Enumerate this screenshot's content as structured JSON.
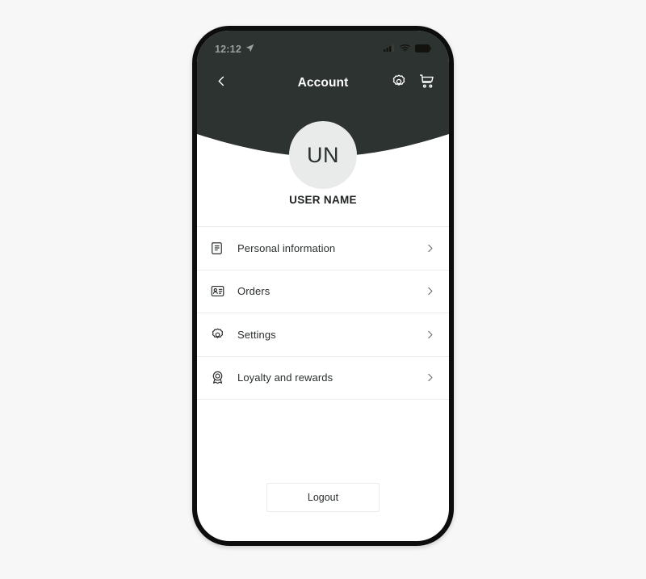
{
  "theme": {
    "page_background": "#f7f7f7",
    "header_dark": "#2d3330",
    "screen_background": "#ffffff",
    "frame_black": "#0d0d0d",
    "avatar_background": "#e9ebea",
    "divider": "#ececec",
    "text_primary": "#2a2f2e",
    "text_on_dark": "#ffffff",
    "status_text": "#9aa19c"
  },
  "status_bar": {
    "time": "12:12",
    "location_icon": "location-arrow-icon",
    "signal_icon": "cellular-signal-icon",
    "wifi_icon": "wifi-icon",
    "battery_icon": "battery-icon"
  },
  "nav_bar": {
    "back_icon": "chevron-left-icon",
    "title": "Account",
    "actions": [
      {
        "icon": "gear-icon",
        "name": "settings-button"
      },
      {
        "icon": "shopping-cart-icon",
        "name": "cart-button"
      }
    ]
  },
  "profile": {
    "initials": "UN",
    "name": "USER NAME"
  },
  "menu": {
    "items": [
      {
        "label": "Personal information",
        "icon": "document-person-icon",
        "chevron": "chevron-right-icon"
      },
      {
        "label": "Orders",
        "icon": "id-card-icon",
        "chevron": "chevron-right-icon"
      },
      {
        "label": "Settings",
        "icon": "gear-icon",
        "chevron": "chevron-right-icon"
      },
      {
        "label": "Loyalty and rewards",
        "icon": "award-medal-icon",
        "chevron": "chevron-right-icon"
      }
    ]
  },
  "footer": {
    "logout_label": "Logout"
  }
}
